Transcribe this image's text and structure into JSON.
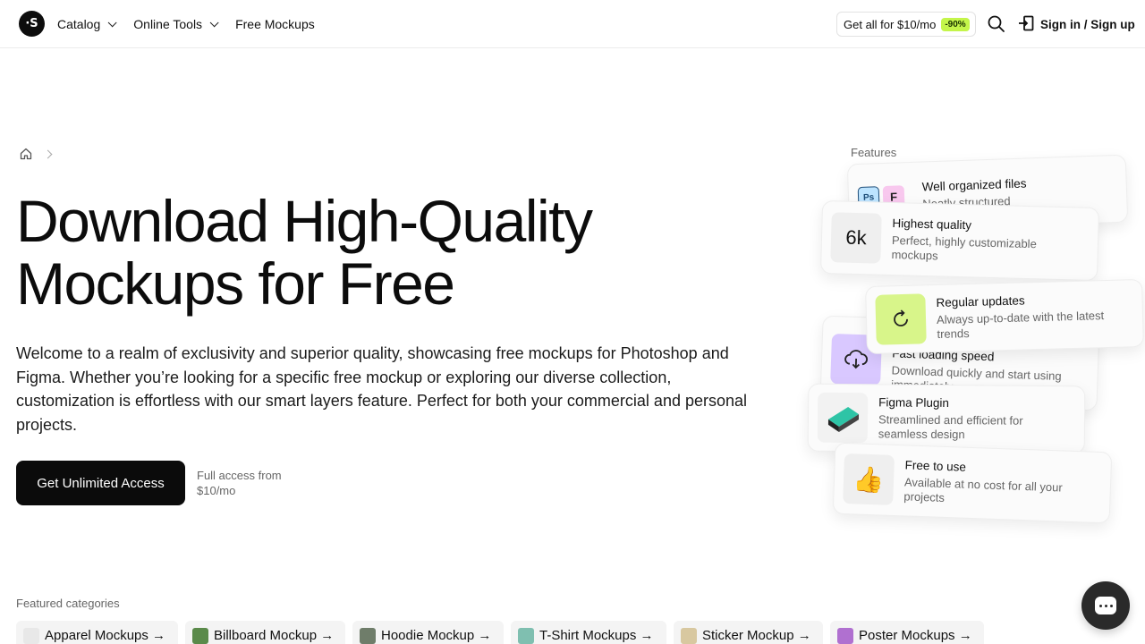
{
  "header": {
    "logo_text": "·S",
    "nav": [
      {
        "label": "Catalog",
        "has_dropdown": true
      },
      {
        "label": "Online Tools",
        "has_dropdown": true
      },
      {
        "label": "Free Mockups",
        "has_dropdown": false
      }
    ],
    "promo": {
      "label": "Get all for $10/mo",
      "badge": "-90%"
    },
    "search_icon": "search-icon",
    "signin_label": "Sign in / Sign up"
  },
  "breadcrumb": {
    "home_icon": "home-icon"
  },
  "hero": {
    "title_line1": "Download High-Quality",
    "title_line2": "Mockups for Free",
    "description": "Welcome to a realm of exclusivity and superior quality, showcasing free mockups for Photoshop and Figma. Whether you’re looking for a specific free mockup or exploring our diverse collection, customization is effortless with our smart layers feature. Perfect for both your commercial and personal projects.",
    "cta_label": "Get Unlimited Access",
    "cta_note": "Full access from $10/mo"
  },
  "features": {
    "label": "Features",
    "cards": [
      {
        "title": "Well organized files",
        "desc": "Neatly structured",
        "icon": "ps-figma-icons"
      },
      {
        "title": "Highest quality",
        "desc": "Perfect, highly customizable mockups",
        "icon_text": "6k"
      },
      {
        "title": "Fast loading speed",
        "desc": "Download quickly and start using immediately",
        "icon": "cloud-download-icon",
        "title_visible": "ing speed"
      },
      {
        "title": "Regular updates",
        "desc": "Always up-to-date with the latest trends",
        "icon": "refresh-icon"
      },
      {
        "title": "Figma Plugin",
        "desc": "Streamlined and efficient for seamless design",
        "icon": "plugin-icon"
      },
      {
        "title": "Free to use",
        "desc": "Available at no cost for all your projects",
        "icon_text": "👍"
      }
    ]
  },
  "categories": {
    "label": "Featured categories",
    "items": [
      {
        "label": "Apparel Mockups →",
        "color": "#e8e8e8"
      },
      {
        "label": "Billboard Mockup →",
        "color": "#5a8a4a"
      },
      {
        "label": "Hoodie Mockup →",
        "color": "#6f7d6a"
      },
      {
        "label": "T-Shirt Mockups →",
        "color": "#7fbfb0"
      },
      {
        "label": "Sticker Mockup →",
        "color": "#d8c8a0"
      },
      {
        "label": "Poster Mockups →",
        "color": "#b070d0"
      }
    ]
  },
  "colors": {
    "accent": "#c4f54a",
    "refresh_bg": "#d8f58a",
    "cloud_bg": "#d9c8ff",
    "dark": "#0b0b0b"
  }
}
